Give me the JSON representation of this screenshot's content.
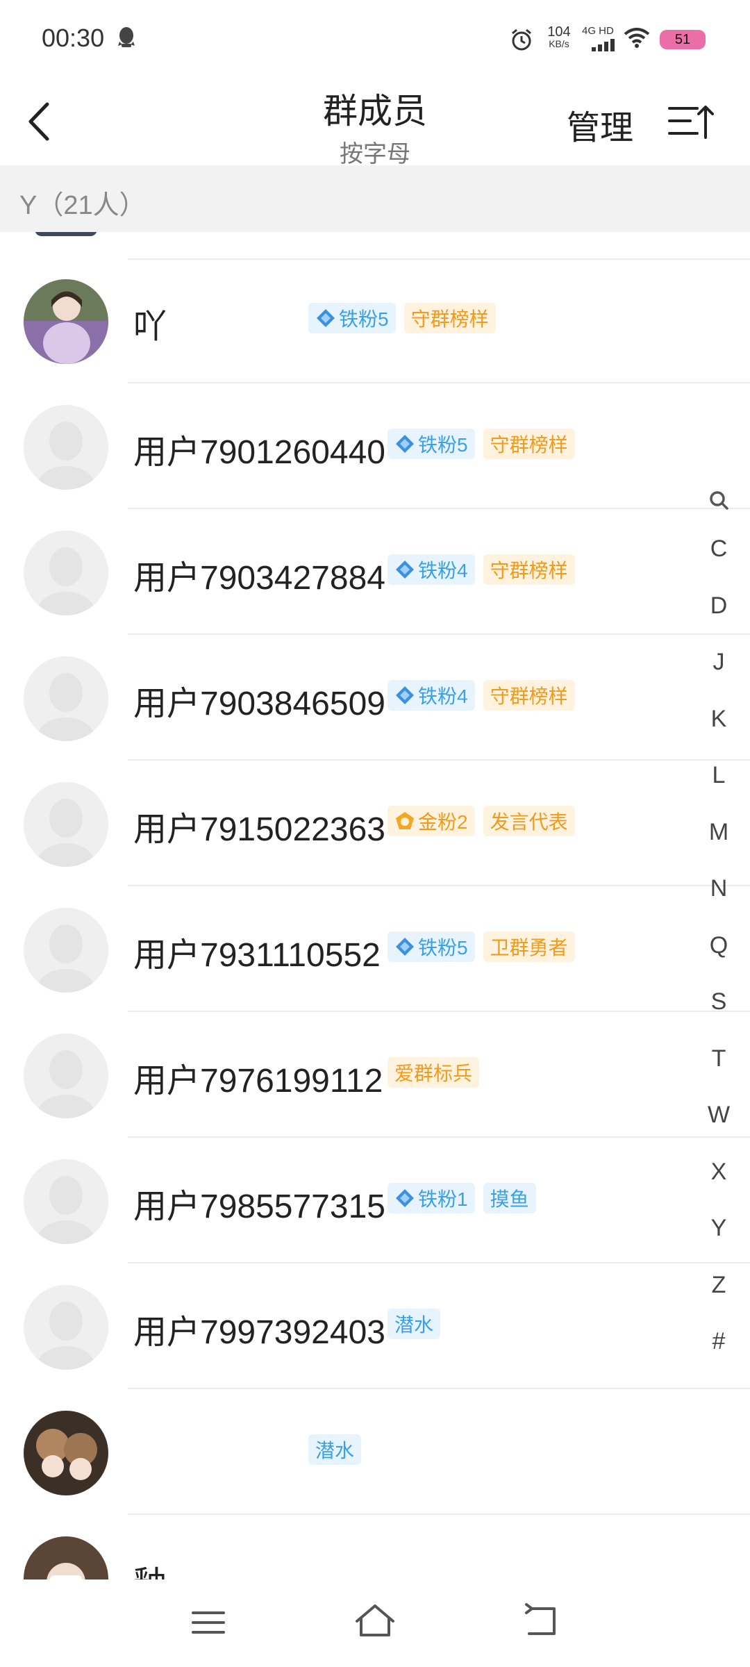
{
  "status_bar": {
    "time": "00:30",
    "net_speed_value": "104",
    "net_speed_unit": "KB/s",
    "net_type": "4G HD",
    "battery": "51",
    "battery_color": "#e96fa6"
  },
  "header": {
    "title": "群成员",
    "subtitle": "按字母",
    "manage_label": "管理"
  },
  "section": {
    "label": "Y（21人）"
  },
  "members": [
    {
      "name": "吖",
      "avatar": "photo",
      "badges": [
        {
          "text": "铁粉5",
          "style": "blue",
          "icon": "diamond-icon"
        },
        {
          "text": "守群榜样",
          "style": "orange"
        }
      ]
    },
    {
      "name": "用户7901260440",
      "avatar": "default",
      "badges": [
        {
          "text": "铁粉5",
          "style": "blue",
          "icon": "diamond-icon"
        },
        {
          "text": "守群榜样",
          "style": "orange"
        }
      ]
    },
    {
      "name": "用户7903427884",
      "avatar": "default",
      "badges": [
        {
          "text": "铁粉4",
          "style": "blue",
          "icon": "diamond-icon"
        },
        {
          "text": "守群榜样",
          "style": "orange"
        }
      ]
    },
    {
      "name": "用户7903846509",
      "avatar": "default",
      "badges": [
        {
          "text": "铁粉4",
          "style": "blue",
          "icon": "diamond-icon"
        },
        {
          "text": "守群榜样",
          "style": "orange"
        }
      ]
    },
    {
      "name": "用户7915022363",
      "avatar": "default",
      "badges": [
        {
          "text": "金粉2",
          "style": "orange",
          "icon": "gold-pentagon-icon"
        },
        {
          "text": "发言代表",
          "style": "orange"
        }
      ]
    },
    {
      "name": "用户7931110552",
      "avatar": "default",
      "badges": [
        {
          "text": "铁粉5",
          "style": "blue",
          "icon": "diamond-icon"
        },
        {
          "text": "卫群勇者",
          "style": "orange"
        }
      ]
    },
    {
      "name": "用户7976199112",
      "avatar": "default",
      "badges": [
        {
          "text": "爱群标兵",
          "style": "orange"
        }
      ]
    },
    {
      "name": "用户7985577315",
      "avatar": "default",
      "badges": [
        {
          "text": "铁粉1",
          "style": "blue",
          "icon": "diamond-icon"
        },
        {
          "text": "摸鱼",
          "style": "blue"
        }
      ]
    },
    {
      "name": "用户7997392403",
      "avatar": "default",
      "badges": [
        {
          "text": "潜水",
          "style": "blue"
        }
      ]
    },
    {
      "name": "",
      "avatar": "photo2",
      "badges": [
        {
          "text": "潜水",
          "style": "blue"
        }
      ]
    },
    {
      "name": "釉",
      "avatar": "photo3",
      "badges": []
    }
  ],
  "alpha_index": [
    "C",
    "D",
    "J",
    "K",
    "L",
    "M",
    "N",
    "Q",
    "S",
    "T",
    "W",
    "X",
    "Y",
    "Z",
    "#"
  ],
  "colors": {
    "badge_blue_bg": "#e8f4fd",
    "badge_blue_text": "#3aa0e6",
    "badge_orange_bg": "#fff2de",
    "badge_orange_text": "#f29a1a",
    "section_bg": "#f2f2f2"
  }
}
